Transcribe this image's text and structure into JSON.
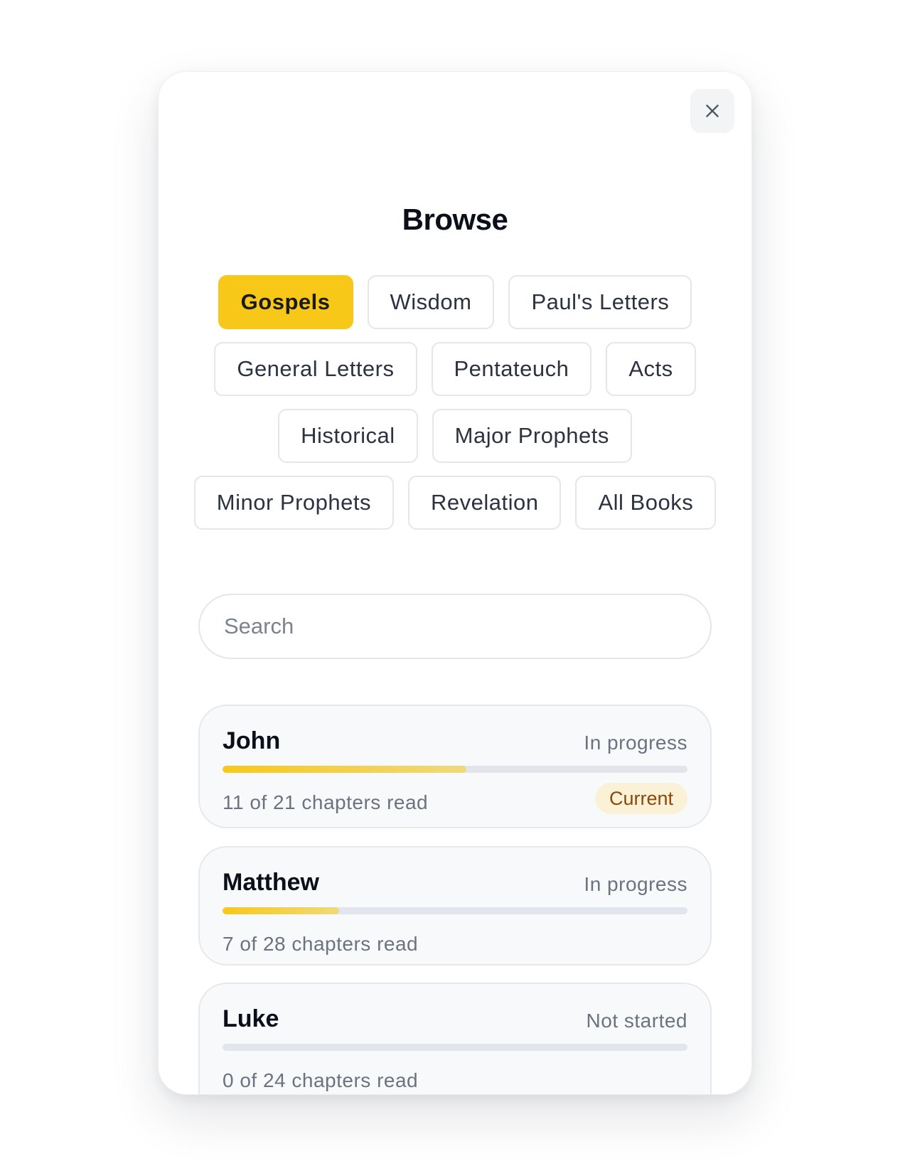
{
  "header": {
    "title": "Browse",
    "close_icon": "close-icon"
  },
  "categories": [
    {
      "label": "Gospels",
      "active": true
    },
    {
      "label": "Wisdom",
      "active": false
    },
    {
      "label": "Paul's Letters",
      "active": false
    },
    {
      "label": "General Letters",
      "active": false
    },
    {
      "label": "Pentateuch",
      "active": false
    },
    {
      "label": "Acts",
      "active": false
    },
    {
      "label": "Historical",
      "active": false
    },
    {
      "label": "Major Prophets",
      "active": false
    },
    {
      "label": "Minor Prophets",
      "active": false
    },
    {
      "label": "Revelation",
      "active": false
    },
    {
      "label": "All Books",
      "active": false
    }
  ],
  "search": {
    "placeholder": "Search",
    "value": ""
  },
  "books": [
    {
      "name": "John",
      "status": "In progress",
      "progress_text": "11 of 21 chapters read",
      "progress": 0.5238,
      "badge": "Current"
    },
    {
      "name": "Matthew",
      "status": "In progress",
      "progress_text": "7 of 28 chapters read",
      "progress": 0.25
    },
    {
      "name": "Luke",
      "status": "Not started",
      "progress_text": "0 of 24 chapters read",
      "progress": 0
    }
  ],
  "colors": {
    "accent": "#f8c818",
    "badge_bg": "#fbf1d6",
    "badge_text": "#8a4a0b"
  }
}
